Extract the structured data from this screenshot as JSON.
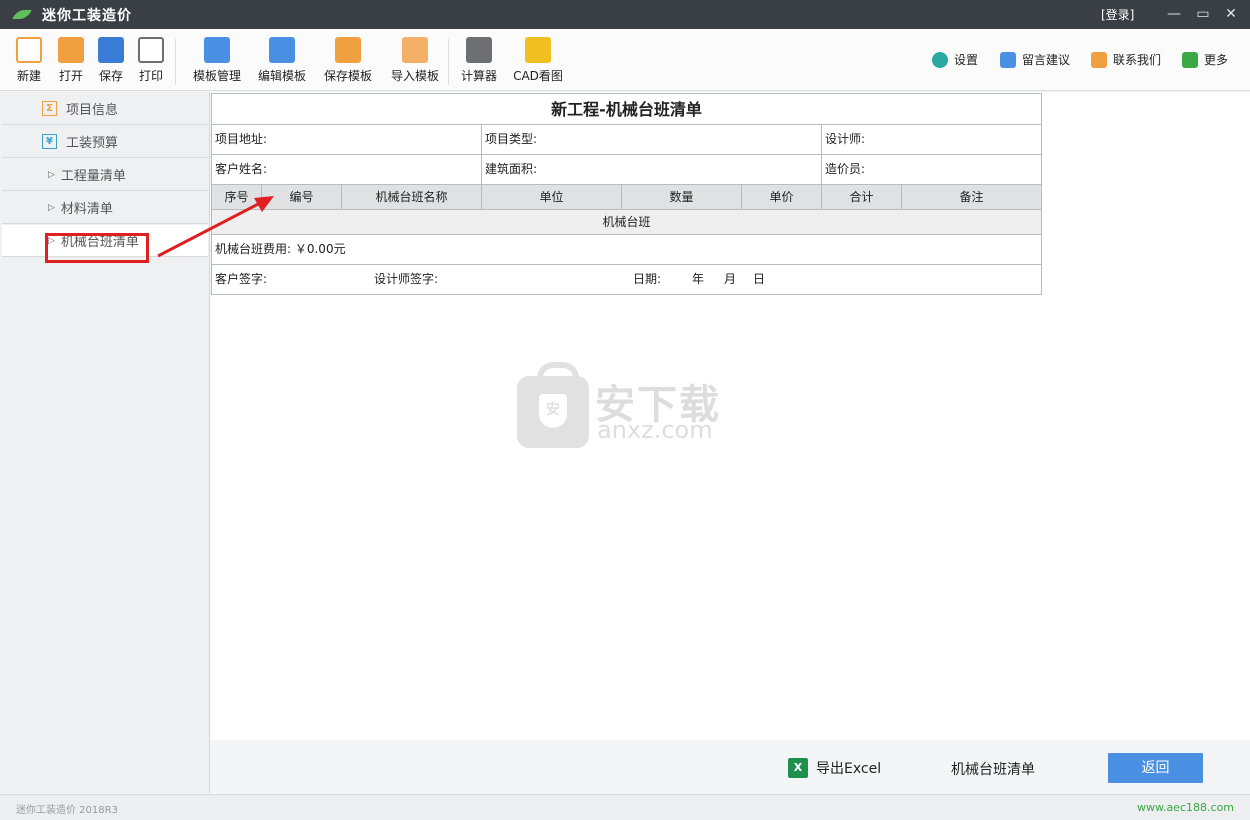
{
  "app": {
    "title": "迷你工装造价",
    "login": "[登录]",
    "version": "迷你工装造价 2018R3",
    "site": "www.aec188.com"
  },
  "toolbar": {
    "items": [
      {
        "label": "新建",
        "icon": "new-file-icon",
        "color": "#f0a040"
      },
      {
        "label": "打开",
        "icon": "open-folder-icon",
        "color": "#f0a040"
      },
      {
        "label": "保存",
        "icon": "save-icon",
        "color": "#3a7bd5"
      },
      {
        "label": "打印",
        "icon": "printer-icon",
        "color": "#6d6f72"
      },
      {
        "label": "模板管理",
        "icon": "template-manage-icon",
        "color": "#4a90e2"
      },
      {
        "label": "编辑模板",
        "icon": "edit-template-icon",
        "color": "#4a90e2"
      },
      {
        "label": "保存模板",
        "icon": "save-template-icon",
        "color": "#f0a040"
      },
      {
        "label": "导入模板",
        "icon": "import-template-icon",
        "color": "#f0a040"
      },
      {
        "label": "计算器",
        "icon": "calculator-icon",
        "color": "#6d6f72"
      },
      {
        "label": "CAD看图",
        "icon": "cad-dwg-icon",
        "color": "#3a7bd5"
      }
    ],
    "right": [
      {
        "label": "设置",
        "icon": "gear-icon",
        "color": "#2aa8a0"
      },
      {
        "label": "留言建议",
        "icon": "feedback-icon",
        "color": "#4a90e2"
      },
      {
        "label": "联系我们",
        "icon": "mail-icon",
        "color": "#f0a040"
      },
      {
        "label": "更多",
        "icon": "more-icon",
        "color": "#39a845"
      }
    ]
  },
  "sidebar": {
    "items": [
      {
        "label": "项目信息",
        "icon_char": "Σ",
        "icon_color": "#f0a040"
      },
      {
        "label": "工装预算",
        "icon_char": "¥",
        "icon_color": "#3aa0c8"
      },
      {
        "label": "工程量清单"
      },
      {
        "label": "材料清单"
      },
      {
        "label": "机械台班清单"
      }
    ]
  },
  "doc": {
    "title": "新工程-机械台班清单",
    "info": {
      "address": "项目地址:",
      "type": "项目类型:",
      "designer": "设计师:",
      "client": "客户姓名:",
      "area": "建筑面积:",
      "estimator": "造价员:"
    },
    "columns": [
      "序号",
      "编号",
      "机械台班名称",
      "单位",
      "数量",
      "单价",
      "合计",
      "备注"
    ],
    "section": "机械台班",
    "fee": "机械台班费用: ￥0.00元",
    "signature": {
      "client": "客户签字:",
      "designer": "设计师签字:",
      "date": "日期:",
      "year": "年",
      "month": "月",
      "day": "日"
    }
  },
  "watermark": {
    "cn": "安下载",
    "en": "anxz.com",
    "shield": "安"
  },
  "footer": {
    "export": "导出Excel",
    "label": "机械台班清单",
    "back": "返回"
  }
}
